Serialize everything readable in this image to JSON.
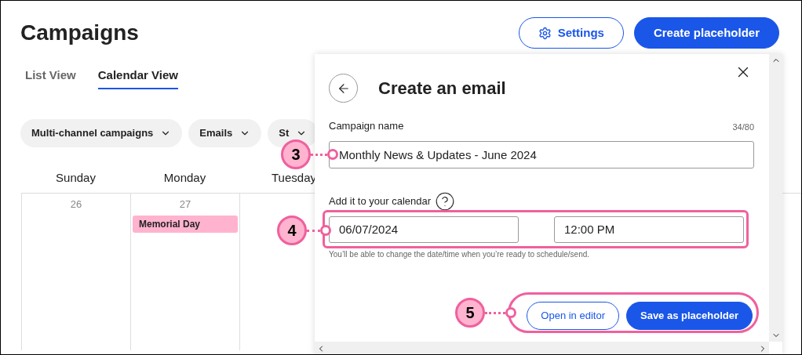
{
  "page": {
    "title": "Campaigns"
  },
  "header_buttons": [
    {
      "kind": "outline",
      "label": "Settings"
    },
    {
      "kind": "primary",
      "label": "Create placeholder"
    }
  ],
  "tabs": [
    {
      "label": "List View",
      "selected": false
    },
    {
      "label": "Calendar View",
      "selected": true
    }
  ],
  "filters": [
    {
      "label": "Multi-channel campaigns"
    },
    {
      "label": "Emails"
    },
    {
      "label": "St"
    }
  ],
  "calendar": {
    "days": [
      "Sunday",
      "Monday",
      "Tuesday"
    ],
    "cells": [
      {
        "date": "26"
      },
      {
        "date": "27",
        "events": [
          {
            "label": "Memorial Day",
            "color": "#ffb3cf"
          }
        ]
      },
      {}
    ]
  },
  "dialog": {
    "title": "Create an email",
    "name_field": {
      "label": "Campaign name",
      "counter": "34/80",
      "value": "Monthly News & Updates - June 2024"
    },
    "schedule": {
      "label": "Add it to your calendar",
      "date": "06/07/2024",
      "time": "12:00 PM",
      "hint": "You’ll be able to change the date/time when you’re ready to schedule/send."
    },
    "buttons": [
      {
        "kind": "outline",
        "label": "Open in editor"
      },
      {
        "kind": "primary",
        "label": "Save as placeholder"
      }
    ]
  },
  "callouts": [
    {
      "number": "3"
    },
    {
      "number": "4"
    },
    {
      "number": "5"
    }
  ]
}
